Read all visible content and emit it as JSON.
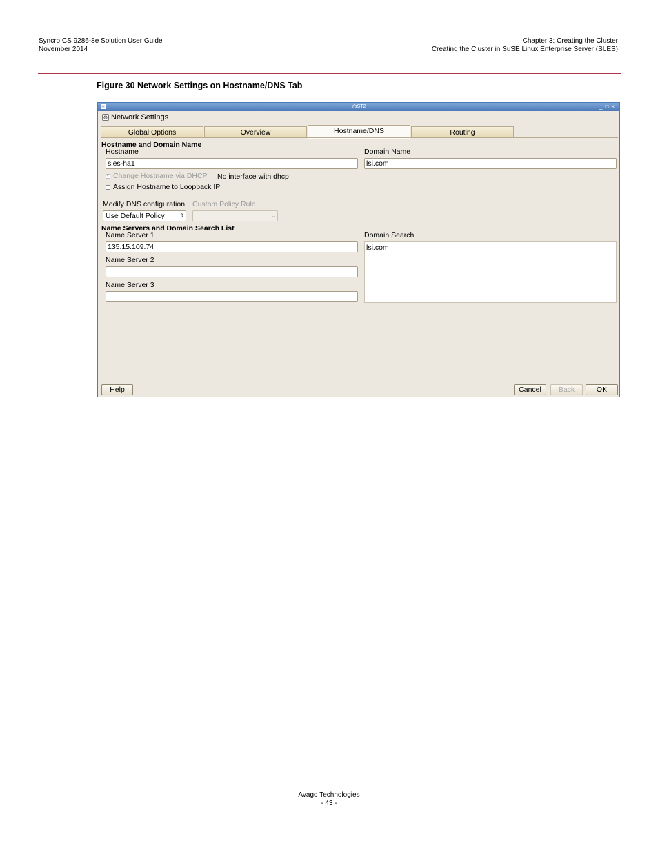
{
  "header": {
    "doc_title": "Syncro CS 9286-8e Solution User Guide",
    "date": "November 2014",
    "chapter": "Chapter 3: Creating the Cluster",
    "section": "Creating the Cluster in SuSE Linux Enterprise Server (SLES)"
  },
  "figure": {
    "caption": "Figure 30  Network Settings on Hostname/DNS Tab"
  },
  "window": {
    "title": "YaST2",
    "subtitle": "Network Settings",
    "tabs": [
      {
        "label": "Global Options",
        "active": false
      },
      {
        "label": "Overview",
        "active": false
      },
      {
        "label": "Hostname/DNS",
        "active": true
      },
      {
        "label": "Routing",
        "active": false
      }
    ],
    "host_section": {
      "heading": "Hostname and Domain Name",
      "hostname_label": "Hostname",
      "hostname_value": "sles-ha1",
      "domain_label": "Domain Name",
      "domain_value": "lsi.com",
      "dhcp_checkbox": "Change Hostname via DHCP",
      "dhcp_note": "No interface with dhcp",
      "loopback_checkbox": "Assign Hostname to Loopback IP"
    },
    "dns_config": {
      "modify_label": "Modify DNS configuration",
      "modify_value": "Use Default Policy",
      "custom_label": "Custom Policy Rule",
      "custom_value": ""
    },
    "servers_section": {
      "heading": "Name Servers and Domain Search List",
      "ns1_label": "Name Server 1",
      "ns1_value": "135.15.109.74",
      "ns2_label": "Name Server 2",
      "ns2_value": "",
      "ns3_label": "Name Server 3",
      "ns3_value": "",
      "search_label": "Domain Search",
      "search_value": "lsi.com"
    },
    "buttons": {
      "help": "Help",
      "cancel": "Cancel",
      "back": "Back",
      "ok": "OK"
    }
  },
  "footer": {
    "company": "Avago Technologies",
    "page": "- 43 -"
  },
  "colors": {
    "rule": "#b0344a",
    "titlebar": "#4c78b6",
    "tab": "#e7d9b4",
    "dialog": "#ece8e0"
  }
}
